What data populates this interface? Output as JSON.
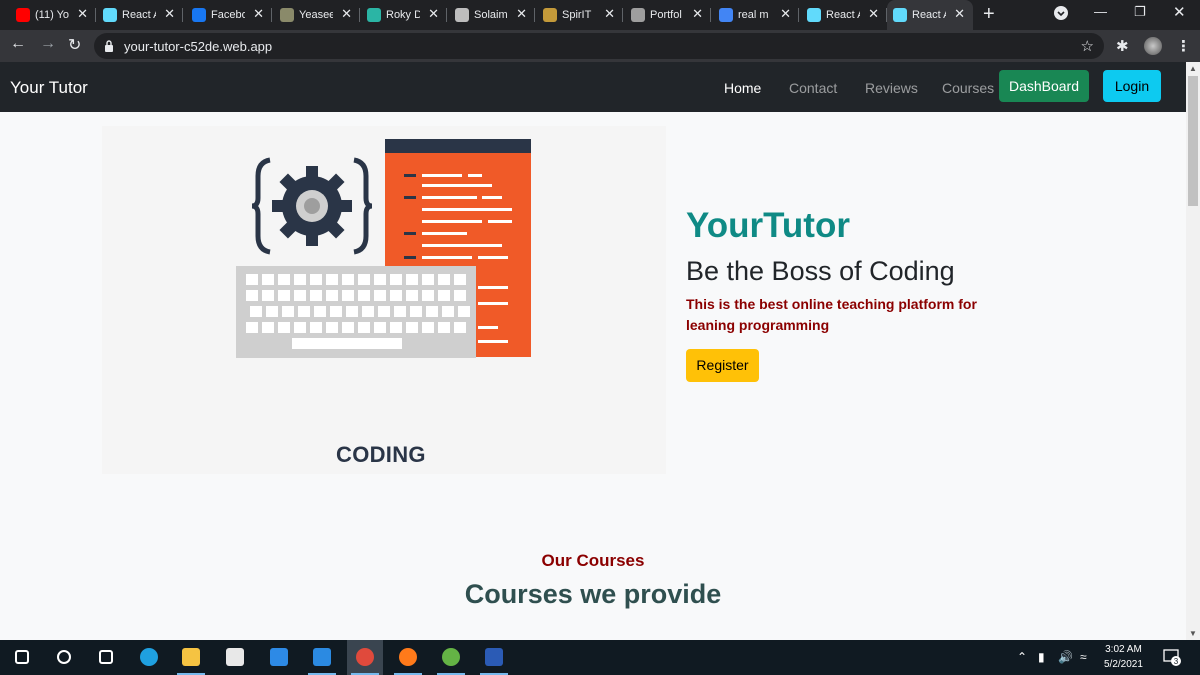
{
  "browser": {
    "tabs": [
      {
        "title": "(11) Yo",
        "favicon": "youtube-icon",
        "color": "#ff0000"
      },
      {
        "title": "React A",
        "favicon": "react-icon",
        "color": "#61dafb"
      },
      {
        "title": "Facebo",
        "favicon": "facebook-icon",
        "color": "#1877f2"
      },
      {
        "title": "Yeasee",
        "favicon": "image-icon",
        "color": "#8a8a6a"
      },
      {
        "title": "Roky D",
        "favicon": "r-logo-icon",
        "color": "#2bb5a5"
      },
      {
        "title": "Solaim",
        "favicon": "github-flow-icon",
        "color": "#bdbdbd"
      },
      {
        "title": "SpirIT",
        "favicon": "book-icon",
        "color": "#c49a3a"
      },
      {
        "title": "Portfol",
        "favicon": "github-icon",
        "color": "#9e9e9e"
      },
      {
        "title": "real m",
        "favicon": "google-icon",
        "color": "#4285f4"
      },
      {
        "title": "React A",
        "favicon": "react-icon",
        "color": "#61dafb"
      },
      {
        "title": "React A",
        "favicon": "react-icon",
        "color": "#61dafb",
        "active": true
      }
    ],
    "url": "your-tutor-c52de.web.app"
  },
  "site": {
    "brand": "Your Tutor",
    "nav": {
      "home": "Home",
      "contact": "Contact",
      "reviews": "Reviews",
      "courses": "Courses",
      "dashboard": "DashBoard",
      "login": "Login"
    },
    "hero": {
      "image_caption": "CODING",
      "title": "YourTutor",
      "subtitle": "Be the Boss of Coding",
      "text": "This is the best online teaching platform for leaning programming",
      "register": "Register"
    },
    "courses_section": {
      "kicker": "Our Courses",
      "title": "Courses we provide"
    }
  },
  "taskbar": {
    "apps": [
      "start-icon",
      "search-icon",
      "task-view-icon",
      "edge-icon",
      "file-explorer-icon",
      "store-icon",
      "mail-icon",
      "vscode-icon",
      "chrome-icon",
      "firefox-icon",
      "utorrent-icon",
      "word-icon"
    ],
    "time": "3:02 AM",
    "date": "5/2/2021",
    "notifications": "3"
  },
  "colors": {
    "brand_teal": "#0f8a85",
    "dark_red": "#8b0000",
    "dashboard_green": "#198754",
    "login_cyan": "#0dcaf0",
    "register_yellow": "#ffc107",
    "illustration_orange": "#f05a28"
  }
}
